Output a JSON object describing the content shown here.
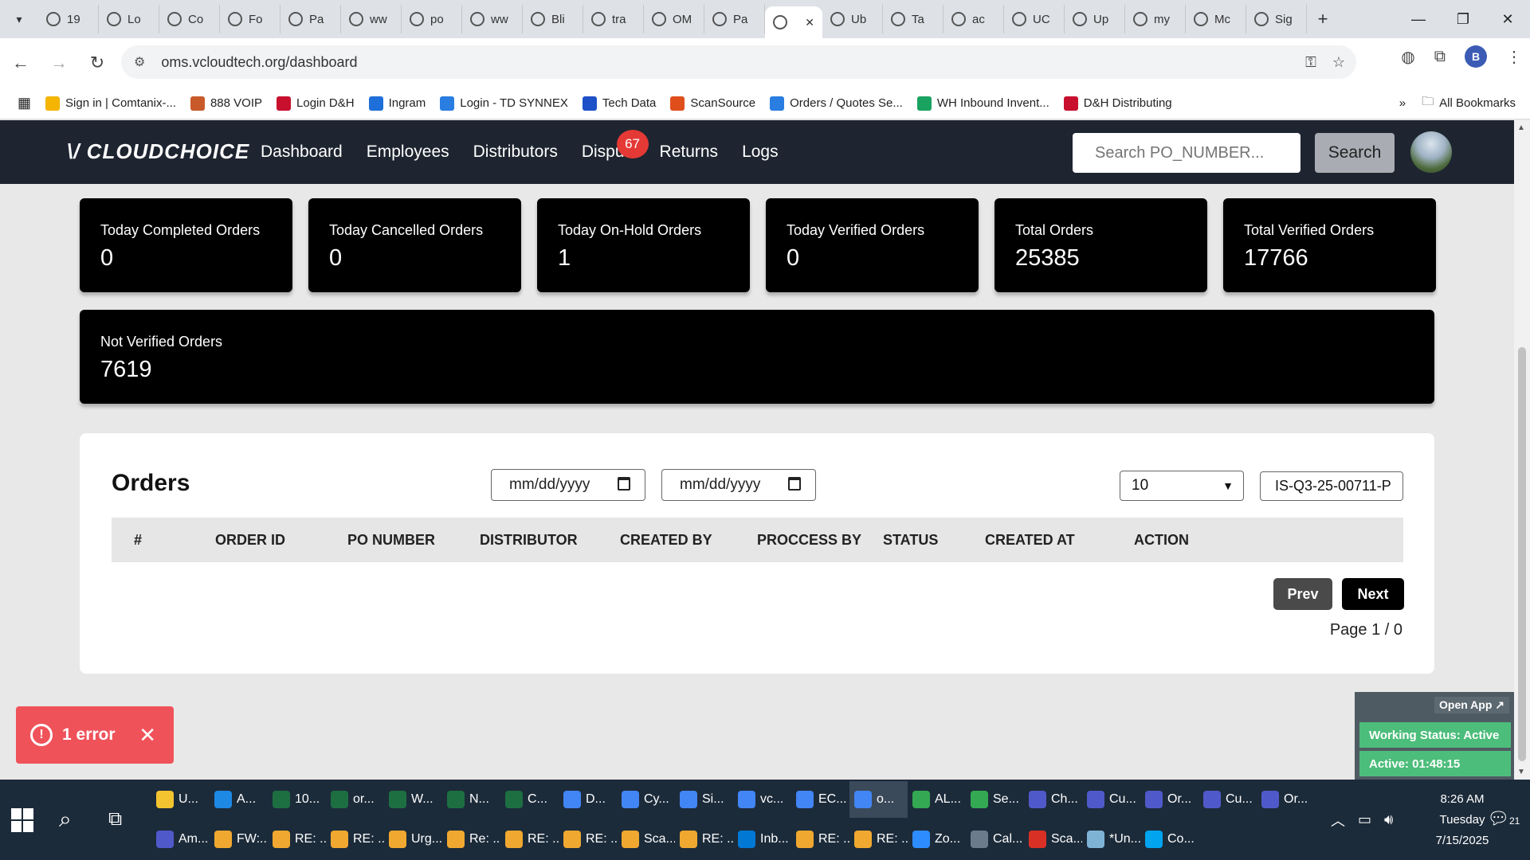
{
  "browser": {
    "tabs": [
      {
        "label": "19",
        "active": false
      },
      {
        "label": "Lo",
        "active": false
      },
      {
        "label": "Co",
        "active": false
      },
      {
        "label": "Fo",
        "active": false
      },
      {
        "label": "Pa",
        "active": false
      },
      {
        "label": "ww",
        "active": false
      },
      {
        "label": "po",
        "active": false
      },
      {
        "label": "ww",
        "active": false
      },
      {
        "label": "Bli",
        "active": false
      },
      {
        "label": "tra",
        "active": false
      },
      {
        "label": "OM",
        "active": false
      },
      {
        "label": "Pa",
        "active": false
      },
      {
        "label": "",
        "active": true
      },
      {
        "label": "Ub",
        "active": false
      },
      {
        "label": "Ta",
        "active": false
      },
      {
        "label": "ac",
        "active": false
      },
      {
        "label": "UC",
        "active": false
      },
      {
        "label": "Up",
        "active": false
      },
      {
        "label": "my",
        "active": false
      },
      {
        "label": "Mc",
        "active": false
      },
      {
        "label": "Sig",
        "active": false
      }
    ],
    "url": "oms.vcloudtech.org/dashboard",
    "profile_initial": "B",
    "bookmarks": [
      {
        "label": "Sign in | Comtanix-...",
        "color": "#f4b400"
      },
      {
        "label": "888 VOIP",
        "color": "#c85a2a"
      },
      {
        "label": "Login D&H",
        "color": "#c8102e"
      },
      {
        "label": "Ingram",
        "color": "#1e6fd9"
      },
      {
        "label": "Login - TD SYNNEX",
        "color": "#2a7de1"
      },
      {
        "label": "Tech Data",
        "color": "#1e50c8"
      },
      {
        "label": "ScanSource",
        "color": "#e04e1c"
      },
      {
        "label": "Orders / Quotes Se...",
        "color": "#2a7de1"
      },
      {
        "label": "WH Inbound Invent...",
        "color": "#1aa260"
      },
      {
        "label": "D&H Distributing",
        "color": "#c8102e"
      }
    ],
    "all_bookmarks": "All Bookmarks"
  },
  "app": {
    "logo": "\\/ CLOUDCHOICE",
    "nav": {
      "dashboard": "Dashboard",
      "employees": "Employees",
      "distributors": "Distributors",
      "disputes": "Dispu",
      "disputes_badge": "67",
      "returns": "Returns",
      "logs": "Logs"
    },
    "search_placeholder": "Search PO_NUMBER...",
    "search_button": "Search"
  },
  "stats": [
    {
      "label": "Today Completed Orders",
      "value": "0"
    },
    {
      "label": "Today Cancelled Orders",
      "value": "0"
    },
    {
      "label": "Today On-Hold Orders",
      "value": "1"
    },
    {
      "label": "Today Verified Orders",
      "value": "0"
    },
    {
      "label": "Total Orders",
      "value": "25385"
    },
    {
      "label": "Total Verified Orders",
      "value": "17766"
    }
  ],
  "not_verified": {
    "label": "Not Verified Orders",
    "value": "7619"
  },
  "orders": {
    "title": "Orders",
    "date_from_placeholder": "mm/dd/yyyy",
    "date_to_placeholder": "mm/dd/yyyy",
    "page_size": "10",
    "filter_value": "IS-Q3-25-00711-P",
    "columns": [
      "#",
      "ORDER ID",
      "PO NUMBER",
      "DISTRIBUTOR",
      "CREATED BY",
      "PROCCESS BY",
      "STATUS",
      "CREATED AT",
      "ACTION"
    ],
    "rows": [],
    "prev": "Prev",
    "next": "Next",
    "page_info": "Page 1 / 0"
  },
  "error_toast": {
    "text": "1 error"
  },
  "status_widget": {
    "open_app": "Open App ↗",
    "working_status": "Working Status: Active",
    "active_time": "Active: 01:48:15"
  },
  "taskbar": {
    "row1": [
      {
        "label": "U...",
        "color": "#f4c430"
      },
      {
        "label": "A...",
        "color": "#1e88e5"
      },
      {
        "label": "10...",
        "color": "#1d6f42"
      },
      {
        "label": "or...",
        "color": "#1d6f42"
      },
      {
        "label": "W...",
        "color": "#1d6f42"
      },
      {
        "label": "N...",
        "color": "#1d6f42"
      },
      {
        "label": "C...",
        "color": "#1d6f42"
      },
      {
        "label": "D...",
        "color": "#4285f4"
      },
      {
        "label": "Cy...",
        "color": "#4285f4"
      },
      {
        "label": "Si...",
        "color": "#4285f4"
      },
      {
        "label": "vc...",
        "color": "#4285f4"
      },
      {
        "label": "EC...",
        "color": "#4285f4"
      },
      {
        "label": "o...",
        "color": "#4285f4"
      },
      {
        "label": "AL...",
        "color": "#34a853"
      },
      {
        "label": "Se...",
        "color": "#34a853"
      },
      {
        "label": "Ch...",
        "color": "#5059c9"
      },
      {
        "label": "Cu...",
        "color": "#5059c9"
      },
      {
        "label": "Or...",
        "color": "#5059c9"
      },
      {
        "label": "Cu...",
        "color": "#5059c9"
      },
      {
        "label": "Or...",
        "color": "#5059c9"
      }
    ],
    "row2": [
      {
        "label": "Am...",
        "color": "#5059c9"
      },
      {
        "label": "FW:...",
        "color": "#f0a830"
      },
      {
        "label": "RE: ...",
        "color": "#f0a830"
      },
      {
        "label": "RE: ...",
        "color": "#f0a830"
      },
      {
        "label": "Urg...",
        "color": "#f0a830"
      },
      {
        "label": "Re: ...",
        "color": "#f0a830"
      },
      {
        "label": "RE: ...",
        "color": "#f0a830"
      },
      {
        "label": "RE: ...",
        "color": "#f0a830"
      },
      {
        "label": "Sca...",
        "color": "#f0a830"
      },
      {
        "label": "RE: ...",
        "color": "#f0a830"
      },
      {
        "label": "Inb...",
        "color": "#0078d4"
      },
      {
        "label": "RE: ...",
        "color": "#f0a830"
      },
      {
        "label": "RE: ...",
        "color": "#f0a830"
      },
      {
        "label": "Zo...",
        "color": "#2d8cff"
      },
      {
        "label": "Cal...",
        "color": "#6b7b8c"
      },
      {
        "label": "Sca...",
        "color": "#d93025"
      },
      {
        "label": "*Un...",
        "color": "#7fb3d5"
      },
      {
        "label": "Co...",
        "color": "#00a4ef"
      }
    ],
    "time": "8:26 AM",
    "day": "Tuesday",
    "date": "7/15/2025",
    "notification_count": "21"
  }
}
